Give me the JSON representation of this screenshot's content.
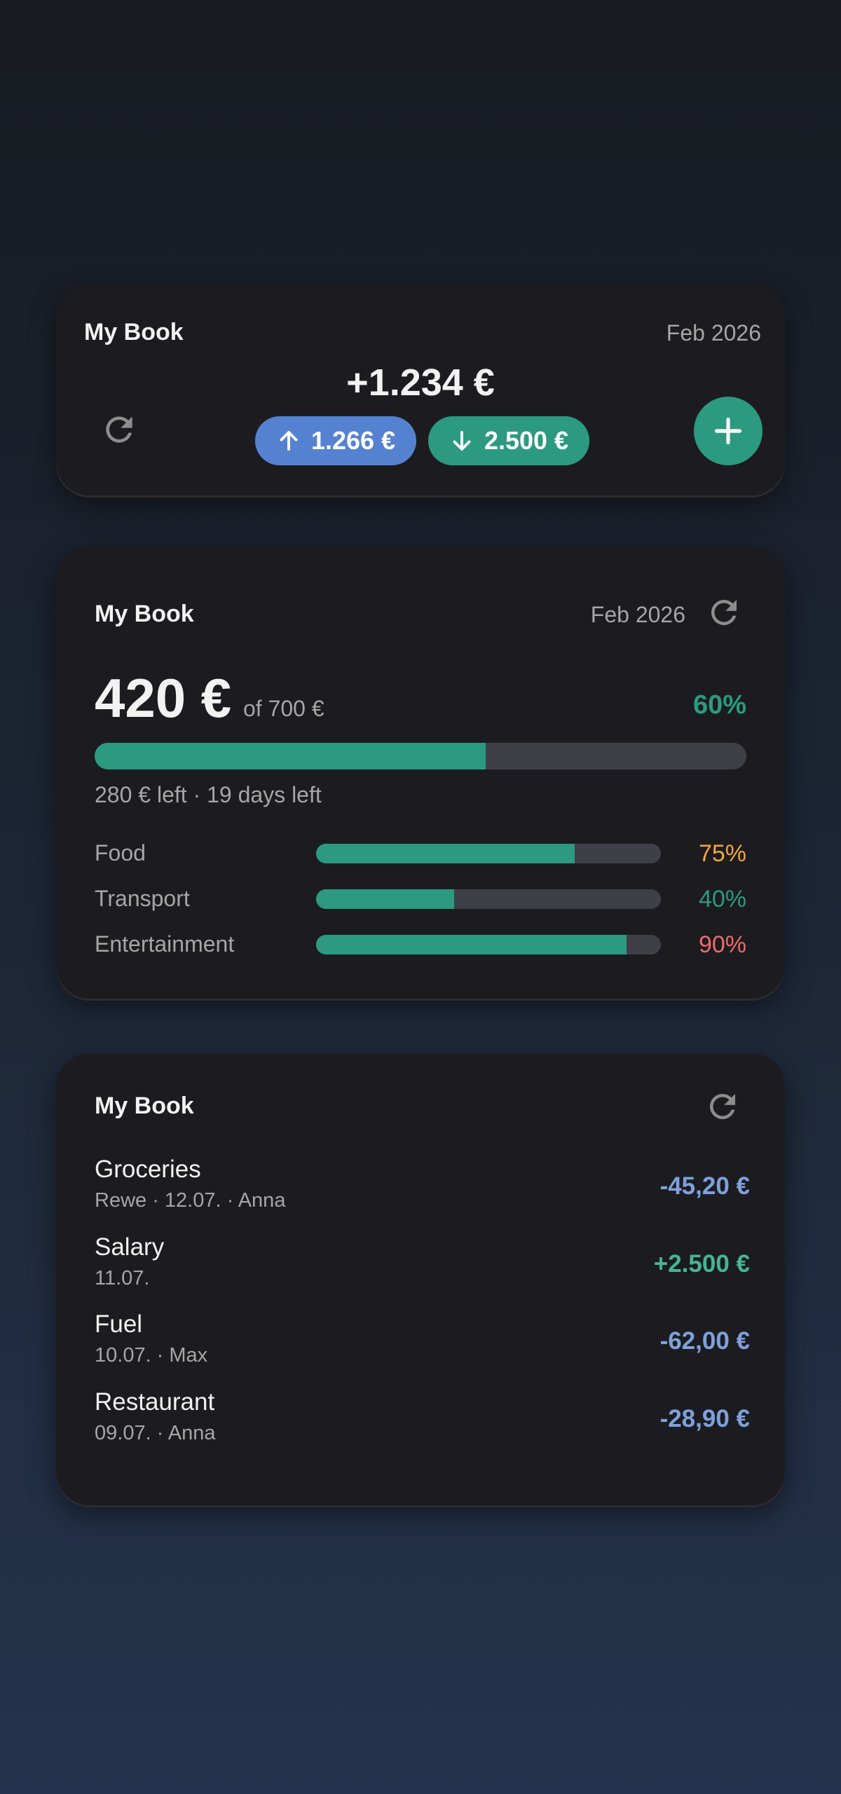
{
  "colors": {
    "accent_green": "#2c9a80",
    "accent_blue": "#5582d0",
    "expense_blue": "#7ea1dc",
    "income_green": "#45b593",
    "warning_orange": "#f0a53b",
    "danger_red": "#ee6b6b"
  },
  "summary_card": {
    "title": "My Book",
    "date": "Feb 2026",
    "balance": "+1.234 €",
    "income_pill": {
      "icon": "arrow-up-icon",
      "amount": "1.266 €"
    },
    "expense_pill": {
      "icon": "arrow-down-icon",
      "amount": "2.500 €"
    },
    "refresh_icon": "refresh-icon",
    "add_icon": "plus-icon"
  },
  "budget_card": {
    "title": "My Book",
    "date": "Feb 2026",
    "spent": "420 €",
    "of_total": "of 700 €",
    "percent": "60%",
    "progress": 0.6,
    "remaining": "280 € left · 19 days left",
    "categories": [
      {
        "label": "Food",
        "percent": "75%",
        "progress": 0.75,
        "color": "#f0a53b"
      },
      {
        "label": "Transport",
        "percent": "40%",
        "progress": 0.4,
        "color": "#2c9a80"
      },
      {
        "label": "Entertainment",
        "percent": "90%",
        "progress": 0.9,
        "color": "#ee6b6b"
      }
    ]
  },
  "transactions_card": {
    "title": "My Book",
    "items": [
      {
        "title": "Groceries",
        "subtitle": "Rewe · 12.07. · Anna",
        "amount": "-45,20 €",
        "color": "#7ea1dc"
      },
      {
        "title": "Salary",
        "subtitle": "11.07.",
        "amount": "+2.500 €",
        "color": "#45b593"
      },
      {
        "title": "Fuel",
        "subtitle": "10.07. · Max",
        "amount": "-62,00 €",
        "color": "#7ea1dc"
      },
      {
        "title": "Restaurant",
        "subtitle": "09.07. · Anna",
        "amount": "-28,90 €",
        "color": "#7ea1dc"
      }
    ]
  }
}
